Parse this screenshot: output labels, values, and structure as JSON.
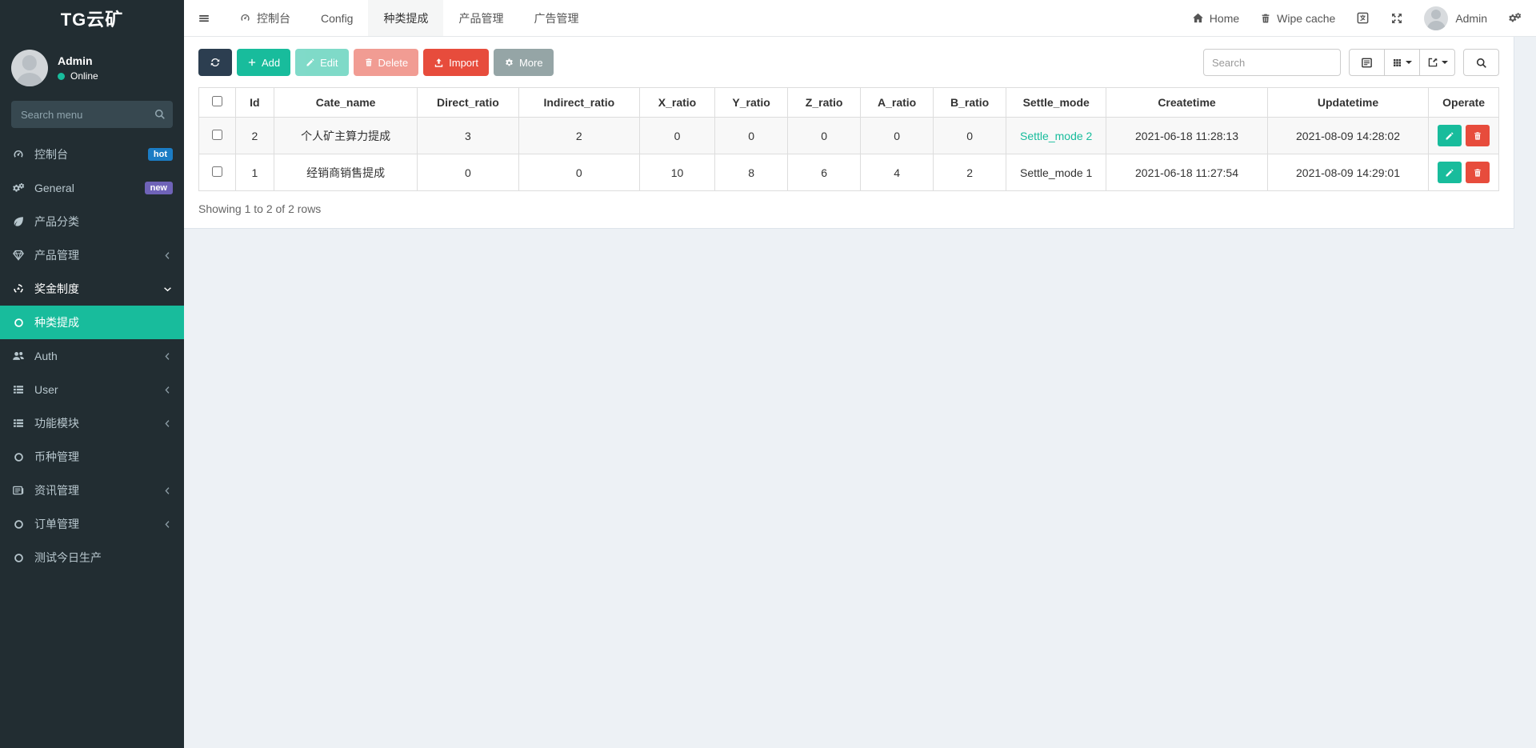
{
  "app": {
    "title": "TG云矿"
  },
  "colors": {
    "accent_teal": "#18bc9c",
    "primary_dark": "#2c3e50",
    "danger_red": "#e74c3c",
    "secondary_gray": "#95a5a6",
    "badge_hot_blue": "#1b7cc4",
    "badge_new_purple": "#6f63b8",
    "sidebar_bg": "#222d32",
    "content_bg": "#edf1f5"
  },
  "sidebar": {
    "user": {
      "name": "Admin",
      "status": "Online"
    },
    "search_placeholder": "Search menu",
    "items": [
      {
        "label": "控制台",
        "icon": "dashboard-icon",
        "badge": "hot"
      },
      {
        "label": "General",
        "icon": "cogs-icon",
        "badge": "new"
      },
      {
        "label": "产品分类",
        "icon": "leaf-icon"
      },
      {
        "label": "产品管理",
        "icon": "gem-icon",
        "chevron": "left"
      },
      {
        "label": "奖金制度",
        "icon": "recycle-icon",
        "chevron": "down",
        "expanded": true
      },
      {
        "label": "种类提成",
        "icon": "circle-icon",
        "active": true
      },
      {
        "label": "Auth",
        "icon": "users-icon",
        "chevron": "left"
      },
      {
        "label": "User",
        "icon": "list-icon",
        "chevron": "left"
      },
      {
        "label": "功能模块",
        "icon": "list-icon",
        "chevron": "left"
      },
      {
        "label": "币种管理",
        "icon": "circle-icon"
      },
      {
        "label": "资讯管理",
        "icon": "newspaper-icon",
        "chevron": "left"
      },
      {
        "label": "订单管理",
        "icon": "circle-icon",
        "chevron": "left"
      },
      {
        "label": "测试今日生产",
        "icon": "circle-icon"
      }
    ]
  },
  "topnav": {
    "tabs": [
      {
        "label": "控制台",
        "icon": "dashboard-icon"
      },
      {
        "label": "Config"
      },
      {
        "label": "种类提成",
        "active": true
      },
      {
        "label": "产品管理"
      },
      {
        "label": "广告管理"
      }
    ],
    "home_label": "Home",
    "wipe_cache_label": "Wipe cache",
    "user_label": "Admin"
  },
  "toolbar": {
    "add_label": "Add",
    "edit_label": "Edit",
    "delete_label": "Delete",
    "import_label": "Import",
    "more_label": "More",
    "search_placeholder": "Search"
  },
  "table": {
    "columns": [
      "Id",
      "Cate_name",
      "Direct_ratio",
      "Indirect_ratio",
      "X_ratio",
      "Y_ratio",
      "Z_ratio",
      "A_ratio",
      "B_ratio",
      "Settle_mode",
      "Createtime",
      "Updatetime",
      "Operate"
    ],
    "rows": [
      {
        "id": "2",
        "cate_name": "个人矿主算力提成",
        "direct_ratio": "3",
        "indirect_ratio": "2",
        "x_ratio": "0",
        "y_ratio": "0",
        "z_ratio": "0",
        "a_ratio": "0",
        "b_ratio": "0",
        "settle_mode": "Settle_mode 2",
        "createtime": "2021-06-18 11:28:13",
        "updatetime": "2021-08-09 14:28:02"
      },
      {
        "id": "1",
        "cate_name": "经销商销售提成",
        "direct_ratio": "0",
        "indirect_ratio": "0",
        "x_ratio": "10",
        "y_ratio": "8",
        "z_ratio": "6",
        "a_ratio": "4",
        "b_ratio": "2",
        "settle_mode": "Settle_mode 1",
        "createtime": "2021-06-18 11:27:54",
        "updatetime": "2021-08-09 14:29:01"
      }
    ],
    "summary": "Showing 1 to 2 of 2 rows"
  }
}
